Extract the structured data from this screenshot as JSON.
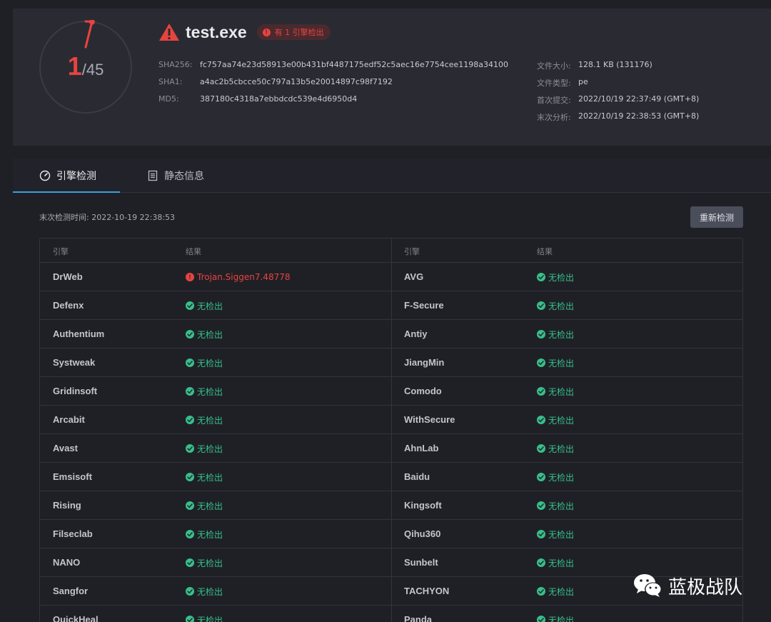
{
  "report": {
    "detection": {
      "count": "1",
      "total": "/45",
      "detected_ratio": 0.0222
    },
    "file_name": "test.exe",
    "badge": {
      "icon_text": "!",
      "text": "有 1 引擎检出"
    },
    "hashes": [
      {
        "label": "SHA256:",
        "value": "fc757aa74e23d58913e00b431bf4487175edf52c5aec16e7754cee1198a34100"
      },
      {
        "label": "SHA1:",
        "value": "a4ac2b5cbcce50c797a13b5e20014897c98f7192"
      },
      {
        "label": "MD5:",
        "value": "387180c4318a7ebbdcdc539e4d6950d4"
      }
    ],
    "meta": [
      {
        "label": "文件大小:",
        "value": "128.1 KB (131176)"
      },
      {
        "label": "文件类型:",
        "value": "pe"
      },
      {
        "label": "首次提交:",
        "value": "2022/10/19 22:37:49 (GMT+8)"
      },
      {
        "label": "末次分析:",
        "value": "2022/10/19 22:38:53 (GMT+8)"
      }
    ]
  },
  "tabs": [
    {
      "label": "引擎检测",
      "icon": "gauge-icon",
      "active": true
    },
    {
      "label": "静态信息",
      "icon": "document-icon",
      "active": false
    }
  ],
  "engine_panel": {
    "last_check": "末次检测时间: 2022-10-19 22:38:53",
    "recheck_label": "重新检测",
    "headers": {
      "engine": "引擎",
      "result": "结果"
    },
    "rows": [
      {
        "left": {
          "engine": "DrWeb",
          "result": "Trojan.Siggen7.48778",
          "status": "detected"
        },
        "right": {
          "engine": "AVG",
          "result": "无检出",
          "status": "clean"
        }
      },
      {
        "left": {
          "engine": "Defenx",
          "result": "无检出",
          "status": "clean"
        },
        "right": {
          "engine": "F-Secure",
          "result": "无检出",
          "status": "clean"
        }
      },
      {
        "left": {
          "engine": "Authentium",
          "result": "无检出",
          "status": "clean"
        },
        "right": {
          "engine": "Antiy",
          "result": "无检出",
          "status": "clean"
        }
      },
      {
        "left": {
          "engine": "Systweak",
          "result": "无检出",
          "status": "clean"
        },
        "right": {
          "engine": "JiangMin",
          "result": "无检出",
          "status": "clean"
        }
      },
      {
        "left": {
          "engine": "Gridinsoft",
          "result": "无检出",
          "status": "clean"
        },
        "right": {
          "engine": "Comodo",
          "result": "无检出",
          "status": "clean"
        }
      },
      {
        "left": {
          "engine": "Arcabit",
          "result": "无检出",
          "status": "clean"
        },
        "right": {
          "engine": "WithSecure",
          "result": "无检出",
          "status": "clean"
        }
      },
      {
        "left": {
          "engine": "Avast",
          "result": "无检出",
          "status": "clean"
        },
        "right": {
          "engine": "AhnLab",
          "result": "无检出",
          "status": "clean"
        }
      },
      {
        "left": {
          "engine": "Emsisoft",
          "result": "无检出",
          "status": "clean"
        },
        "right": {
          "engine": "Baidu",
          "result": "无检出",
          "status": "clean"
        }
      },
      {
        "left": {
          "engine": "Rising",
          "result": "无检出",
          "status": "clean"
        },
        "right": {
          "engine": "Kingsoft",
          "result": "无检出",
          "status": "clean"
        }
      },
      {
        "left": {
          "engine": "Filseclab",
          "result": "无检出",
          "status": "clean"
        },
        "right": {
          "engine": "Qihu360",
          "result": "无检出",
          "status": "clean"
        }
      },
      {
        "left": {
          "engine": "NANO",
          "result": "无检出",
          "status": "clean"
        },
        "right": {
          "engine": "Sunbelt",
          "result": "无检出",
          "status": "clean"
        }
      },
      {
        "left": {
          "engine": "Sangfor",
          "result": "无检出",
          "status": "clean"
        },
        "right": {
          "engine": "TACHYON",
          "result": "无检出",
          "status": "clean"
        }
      },
      {
        "left": {
          "engine": "QuickHeal",
          "result": "无检出",
          "status": "clean"
        },
        "right": {
          "engine": "Panda",
          "result": "无检出",
          "status": "clean"
        }
      }
    ]
  },
  "watermark": {
    "text": "蓝极战队",
    "icon": "wechat-icon"
  },
  "colors": {
    "danger": "#e8433f",
    "clean": "#36c08a",
    "accent": "#3aa0e0",
    "panel": "#2a2b32",
    "background": "#1f2026"
  }
}
